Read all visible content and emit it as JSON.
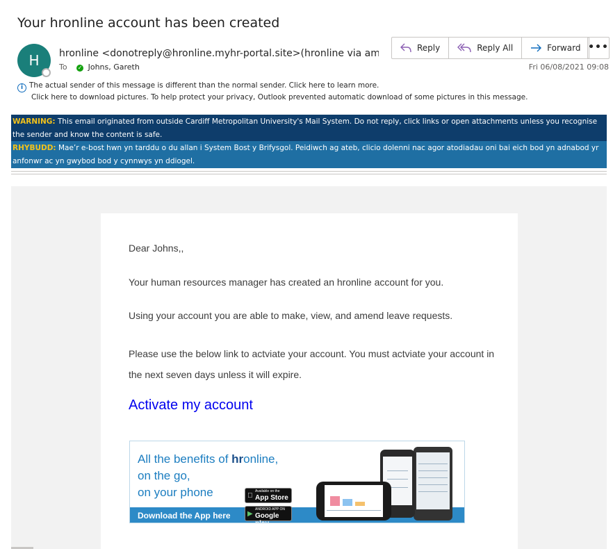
{
  "message": {
    "subject": "Your hronline account has been created",
    "avatar_initial": "H",
    "sender": "hronline <donotreply@hronline.myhr-portal.site>(hronline via amazo",
    "to_label": "To",
    "recipient": "Johns, Gareth",
    "date": "Fri 06/08/2021 09:08"
  },
  "actions": {
    "reply": "Reply",
    "reply_all": "Reply All",
    "forward": "Forward",
    "more": "•••"
  },
  "info_bar": {
    "line1": "The actual sender of this message is different than the normal sender. Click here to learn more.",
    "line2": "Click here to download pictures. To help protect your privacy, Outlook prevented automatic download of some pictures in this message."
  },
  "warnings": {
    "en_label": "WARNING:",
    "en_text": " This email originated from outside Cardiff Metropolitan University's Mail System. Do not reply, click links or open attachments unless you recognise the sender and know the content is safe.",
    "cy_label": "RHYBUDD:",
    "cy_text": " Mae’r e-bost hwn yn tarddu o du allan i System Bost y Brifysgol. Peidiwch ag ateb, clicio dolenni nac agor atodiadau oni bai eich bod yn adnabod yr anfonwr ac yn gwybod bod y cynnwys yn ddiogel."
  },
  "body": {
    "greeting": "Dear Johns,,",
    "p1": "Your human resources manager has created an hronline account for you.",
    "p2": "Using your account you are able to make, view, and amend leave requests.",
    "p3": "Please use the below link to actviate your account. You must actviate your account in the next seven days unless it will expire.",
    "link": "Activate my account"
  },
  "banner": {
    "line1_pre": "All the benefits of ",
    "line1_bold": "hr",
    "line1_post": "online,",
    "line2": "on the go,",
    "line3": "on your phone",
    "download": "Download the App here",
    "appstore_small": "Available on the",
    "appstore_big": "App Store",
    "gplay_small": "ANDROID APP ON",
    "gplay_big": "Google play"
  },
  "colors": {
    "avatar": "#1a7f7a",
    "warning_en_bg": "#0e3d6b",
    "warning_cy_bg": "#1f6fa3",
    "warning_label": "#f3c21b",
    "link": "#0000ee"
  }
}
